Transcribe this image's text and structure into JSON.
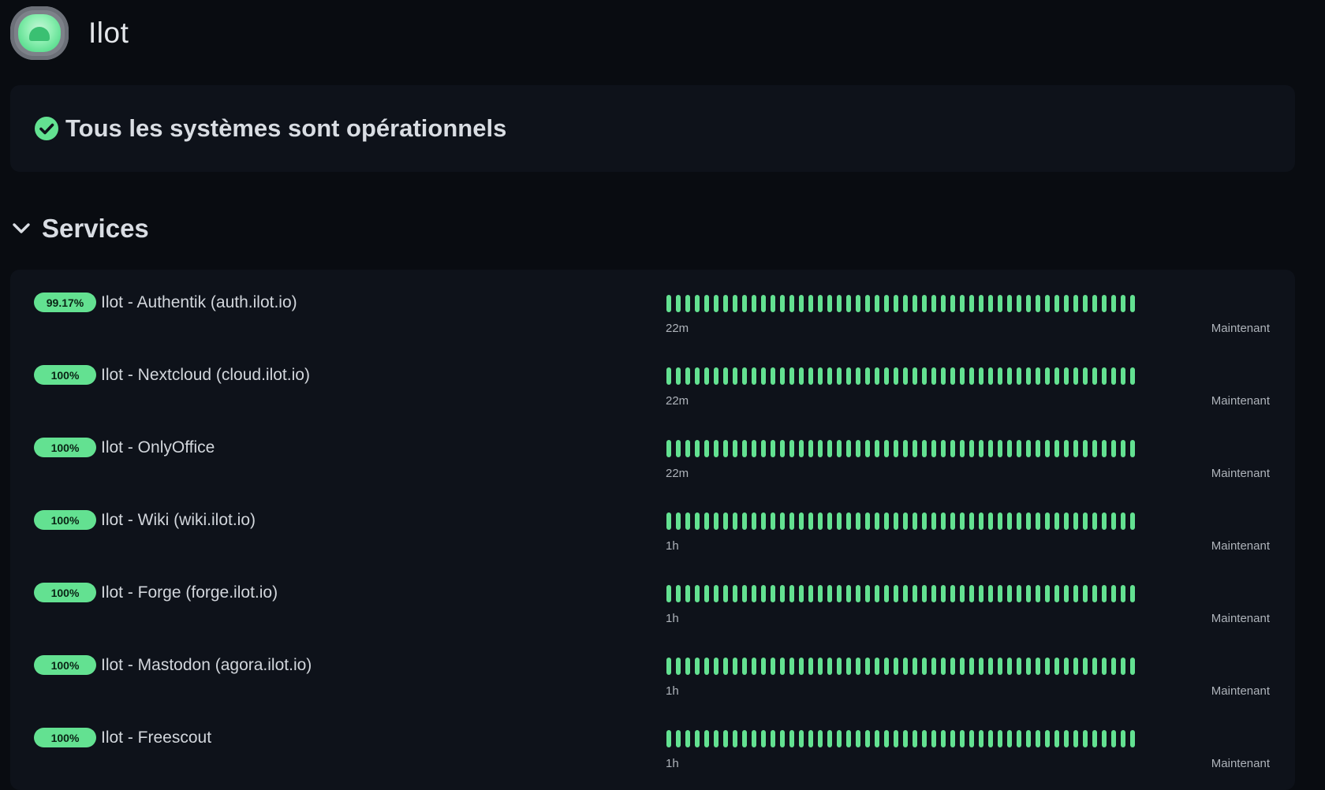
{
  "header": {
    "title": "Ilot",
    "logo_icon": "ilot-logo-icon"
  },
  "status": {
    "icon": "check-circle-icon",
    "text": "Tous les systèmes sont opérationnels",
    "color": "#63e191"
  },
  "services_section": {
    "icon": "chevron-down-icon",
    "title": "Services",
    "bar_color": "#63e191",
    "bars_per_row": 50,
    "items": [
      {
        "uptime": "99.17%",
        "name": "Ilot - Authentik (auth.ilot.io)",
        "range_start": "22m",
        "range_end": "Maintenant"
      },
      {
        "uptime": "100%",
        "name": "Ilot - Nextcloud (cloud.ilot.io)",
        "range_start": "22m",
        "range_end": "Maintenant"
      },
      {
        "uptime": "100%",
        "name": "Ilot - OnlyOffice",
        "range_start": "22m",
        "range_end": "Maintenant"
      },
      {
        "uptime": "100%",
        "name": "Ilot - Wiki (wiki.ilot.io)",
        "range_start": "1h",
        "range_end": "Maintenant"
      },
      {
        "uptime": "100%",
        "name": "Ilot - Forge (forge.ilot.io)",
        "range_start": "1h",
        "range_end": "Maintenant"
      },
      {
        "uptime": "100%",
        "name": "Ilot - Mastodon (agora.ilot.io)",
        "range_start": "1h",
        "range_end": "Maintenant"
      },
      {
        "uptime": "100%",
        "name": "Ilot - Freescout",
        "range_start": "1h",
        "range_end": "Maintenant"
      }
    ]
  }
}
